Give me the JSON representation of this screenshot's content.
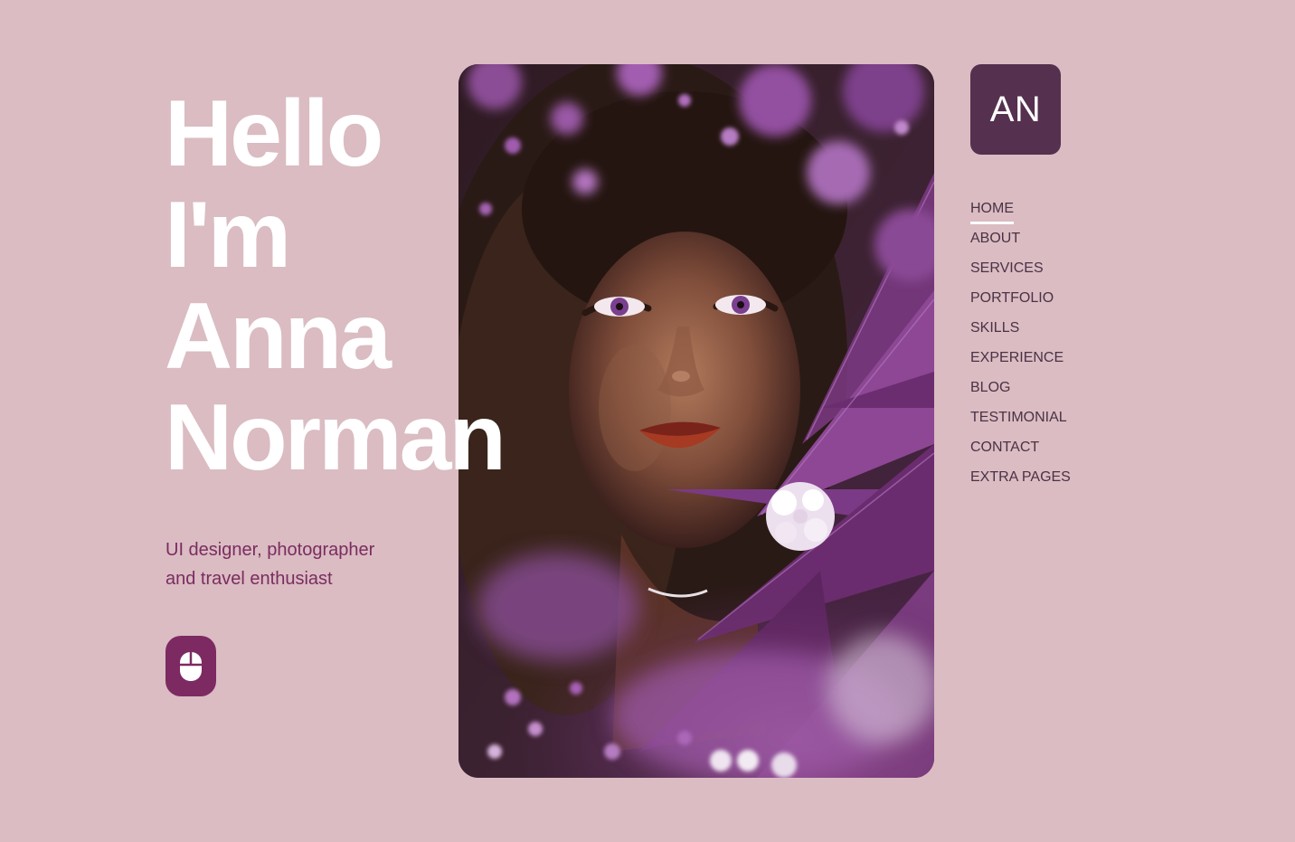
{
  "hero": {
    "line1": "Hello",
    "line2": "I'm",
    "line3": "Anna",
    "line4": "Norman",
    "tagline_line1": "UI designer, photographer",
    "tagline_line2": "and travel enthusiast",
    "scroll_icon": "mouse-icon"
  },
  "logo": {
    "text": "AN"
  },
  "nav": {
    "items": [
      {
        "label": "HOME",
        "active": true
      },
      {
        "label": "ABOUT"
      },
      {
        "label": "SERVICES"
      },
      {
        "label": "PORTFOLIO"
      },
      {
        "label": "SKILLS"
      },
      {
        "label": "EXPERIENCE"
      },
      {
        "label": "BLOG"
      },
      {
        "label": "TESTIMONIAL"
      },
      {
        "label": "CONTACT"
      },
      {
        "label": "EXTRA PAGES"
      }
    ]
  },
  "colors": {
    "background": "#dabcc2",
    "accent": "#7d2a62",
    "logo_bg": "#55304f",
    "heading": "#ffffff",
    "nav_text": "#4a3246"
  }
}
